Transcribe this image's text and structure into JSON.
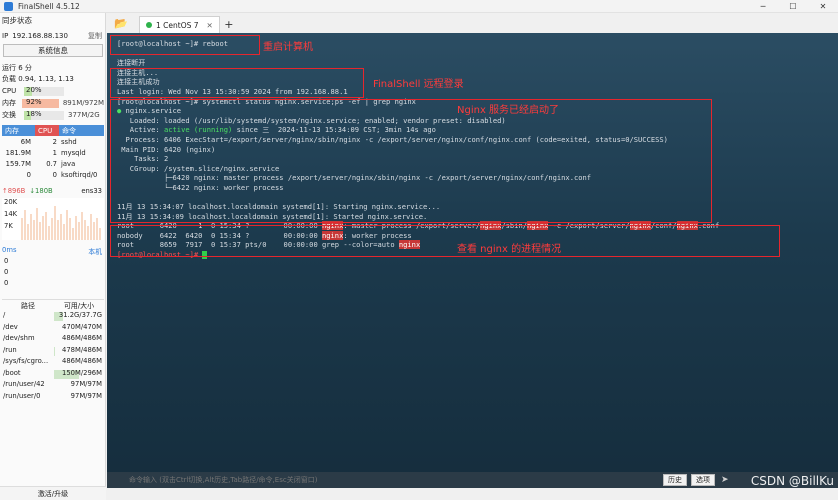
{
  "app": {
    "title": "FinalShell 4.5.12"
  },
  "left": {
    "sync": "同步状态",
    "ip_label": "IP",
    "ip": "192.168.88.130",
    "copy": "复制",
    "sysinfo": "系统信息",
    "uptime": "运行 6 分",
    "load": "负载 0.94, 1.13, 1.13",
    "cpu": {
      "label": "CPU",
      "value": "20%",
      "fraction": 0.2
    },
    "mem": {
      "label": "内存",
      "value": "92%",
      "total": "891M/972M",
      "fraction": 0.92
    },
    "swap": {
      "label": "交换",
      "value": "18%",
      "total": "377M/2G",
      "fraction": 0.18
    },
    "proc_headers": [
      "内存",
      "CPU",
      "命令"
    ],
    "processes": [
      {
        "mem": "6M",
        "cpu": "2",
        "cmd": "sshd"
      },
      {
        "mem": "181.9M",
        "cpu": "1",
        "cmd": "mysqld"
      },
      {
        "mem": "159.7M",
        "cpu": "0.7",
        "cmd": "java"
      },
      {
        "mem": "0",
        "cpu": "0",
        "cmd": "ksoftirqd/0"
      }
    ],
    "net": {
      "up": "↑896B",
      "down": "↓180B",
      "iface": "ens33",
      "yticks": [
        "20K",
        "14K",
        "7K"
      ]
    },
    "latency": {
      "ms": "0ms",
      "loc": "本机",
      "rows": [
        "0",
        "0",
        "0"
      ]
    },
    "disk_headers": [
      "路径",
      "可用/大小"
    ],
    "disks": [
      {
        "path": "/",
        "size": "31.2G/37.7G",
        "used": 0.17
      },
      {
        "path": "/dev",
        "size": "470M/470M",
        "used": 0.0
      },
      {
        "path": "/dev/shm",
        "size": "486M/486M",
        "used": 0.0
      },
      {
        "path": "/run",
        "size": "478M/486M",
        "used": 0.02
      },
      {
        "path": "/sys/fs/cgro...",
        "size": "486M/486M",
        "used": 0.0
      },
      {
        "path": "/boot",
        "size": "150M/296M",
        "used": 0.5
      },
      {
        "path": "/run/user/42",
        "size": "97M/97M",
        "used": 0.0
      },
      {
        "path": "/run/user/0",
        "size": "97M/97M",
        "used": 0.0
      }
    ],
    "upgrade": "激活/升级"
  },
  "tabs": [
    {
      "label": "1 CentOS 7"
    }
  ],
  "terminal": {
    "lines": [
      "[root@localhost ~]# reboot",
      "",
      "连接断开",
      "连接主机...",
      "连接主机成功",
      "Last login: Wed Nov 13 15:30:59 2024 from 192.168.88.1",
      "[root@localhost ~]# systemctl status nginx.service;ps -ef | grep nginx",
      "● nginx.service",
      "   Loaded: loaded (/usr/lib/systemd/system/nginx.service; enabled; vendor preset: disabled)",
      "   Active: active (running) since 三  2024-11-13 15:34:09 CST; 3min 14s ago",
      "  Process: 6406 ExecStart=/export/server/nginx/sbin/nginx -c /export/server/nginx/conf/nginx.conf (code=exited, status=0/SUCCESS)",
      " Main PID: 6420 (nginx)",
      "    Tasks: 2",
      "   CGroup: /system.slice/nginx.service",
      "           ├─6420 nginx: master process /export/server/nginx/sbin/nginx -c /export/server/nginx/conf/nginx.conf",
      "           └─6422 nginx: worker process",
      "",
      "11月 13 15:34:07 localhost.localdomain systemd[1]: Starting nginx.service...",
      "11月 13 15:34:09 localhost.localdomain systemd[1]: Started nginx.service.",
      "root      6420     1  0 15:34 ?        00:00:00 nginx: master process /export/server/nginx/sbin/nginx -c /export/server/nginx/conf/nginx.conf",
      "nobody    6422  6420  0 15:34 ?        00:00:00 nginx: worker process",
      "root      8659  7917  0 15:37 pts/0    00:00:00 grep --color=auto nginx",
      "[root@localhost ~]# "
    ]
  },
  "annotations": {
    "reboot": "重启计算机",
    "relogin": "FinalShell 远程登录",
    "started": "Nginx 服务已经启动了",
    "process": "查看 nginx 的进程情况"
  },
  "cmdbar": {
    "placeholder": "命令输入 (双击Ctrl切换,Alt历史,Tab路径/命令,Esc关闭窗口)",
    "history": "历史",
    "options": "选项"
  },
  "watermark": "CSDN @BillKu",
  "colors": {
    "accent": "#2d7bd6",
    "annotation": "#e6262d",
    "active": "#4be063"
  }
}
